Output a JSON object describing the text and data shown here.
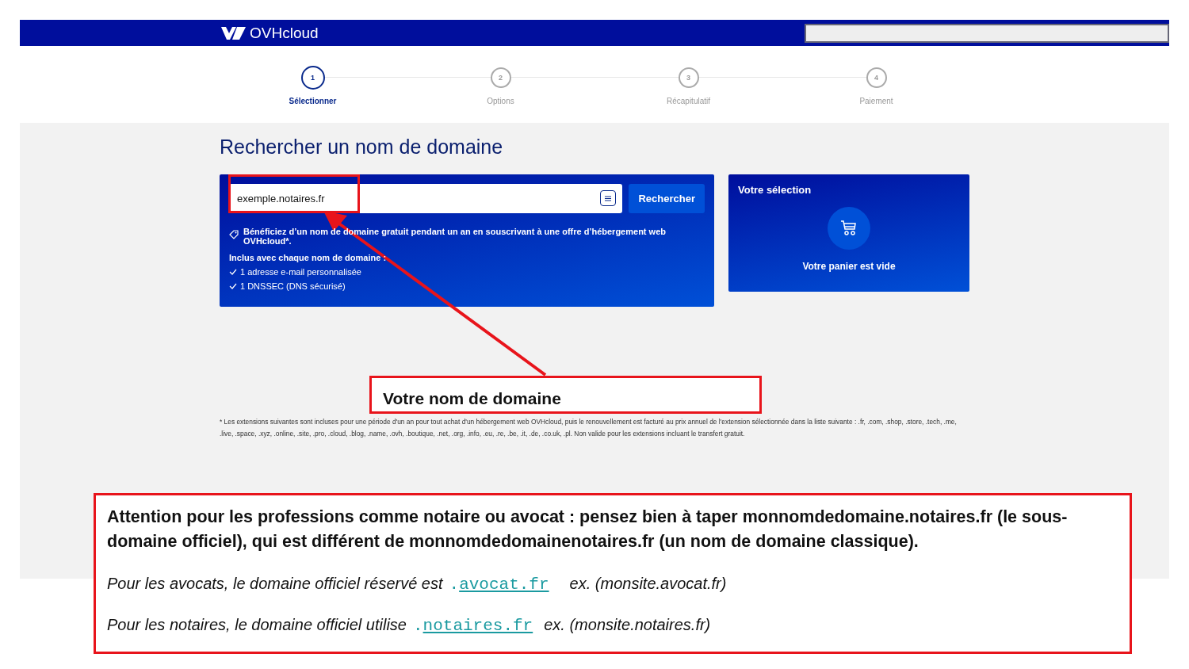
{
  "header": {
    "logo": "OVHcloud"
  },
  "steps": [
    {
      "number": "1",
      "label": "Sélectionner",
      "selected": true
    },
    {
      "number": "2",
      "label": "Options",
      "selected": false
    },
    {
      "number": "3",
      "label": "Récapitulatif",
      "selected": false
    },
    {
      "number": "4",
      "label": "Paiement",
      "selected": false
    }
  ],
  "search": {
    "title": "Rechercher un nom de domaine",
    "value": "exemple.notaires.fr",
    "button": "Rechercher",
    "promo": "Bénéficiez d’un nom de domaine gratuit pendant un an en souscrivant à une offre d’hébergement web OVHcloud*.",
    "included_title": "Inclus avec chaque nom de domaine :",
    "included": [
      "1 adresse e-mail personnalisée",
      "1 DNSSEC (DNS sécurisé)"
    ]
  },
  "selection": {
    "title": "Votre sélection",
    "empty": "Votre panier est vide"
  },
  "footnote": "* Les extensions suivantes sont incluses pour une période d'un an pour tout achat d'un hébergement web OVHcloud, puis le renouvellement est facturé au prix annuel de l'extension sélectionnée dans la liste suivante : .fr, .com, .shop, .store, .tech, .me, .live, .space, .xyz, .online, .site, .pro, .cloud, .blog, .name, .ovh, .boutique, .net, .org, .info, .eu, .re, .be, .it, .de, .co.uk, .pl. Non valide pour les extensions incluant le transfert gratuit.",
  "annotations": {
    "callout": "Votre nom de domaine",
    "warning": "Attention pour les professions comme notaire ou avocat : pensez bien à taper monnomdedomaine.notaires.fr (le sous-domaine officiel), qui est différent de monnomdedomainenotaires.fr (un nom de domaine classique).",
    "lines": [
      {
        "text": "Pour les avocats, le domaine officiel réservé est",
        "prefix": ".",
        "link": "avocat.fr",
        "example": "ex. (monsite.avocat.fr)"
      },
      {
        "text": "Pour les notaires, le domaine officiel utilise",
        "prefix": ".",
        "link": "notaires.fr",
        "example": "ex. (monsite.notaires.fr)"
      }
    ]
  }
}
